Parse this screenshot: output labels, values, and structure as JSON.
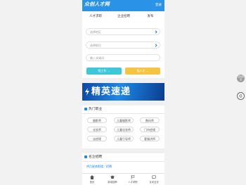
{
  "header": {
    "logo": "众创人才网",
    "login": "登录"
  },
  "tabs": [
    "人才求职",
    "企业招聘",
    "发布"
  ],
  "search": {
    "area_placeholder": "选择地区",
    "position_placeholder": "选择职位",
    "keyword_placeholder": "输入关键词",
    "find_job": "找工作 →",
    "find_talent": "找人才 →"
  },
  "banner": {
    "title": "精英速递",
    "sub": ""
  },
  "hot_jobs": {
    "title": "热门职业",
    "items": [
      "摄影师",
      "儿童摄影师",
      "数码师",
      "化妆师",
      "儿童化妆师",
      "门市经理",
      "店经理",
      "儿童引导师",
      "客服讲师"
    ]
  },
  "famous": {
    "title": "名企招聘",
    "company": "明月星夜影楼／招聘"
  },
  "bottom_nav": [
    "首页",
    "新增招聘",
    "人才求职",
    "互动交流"
  ],
  "side": {
    "btn1": "回到顶部"
  },
  "colors": {
    "primary": "#2a93e8",
    "cyan_button": "#3cc8d8",
    "yellow_button": "#f5c542"
  }
}
